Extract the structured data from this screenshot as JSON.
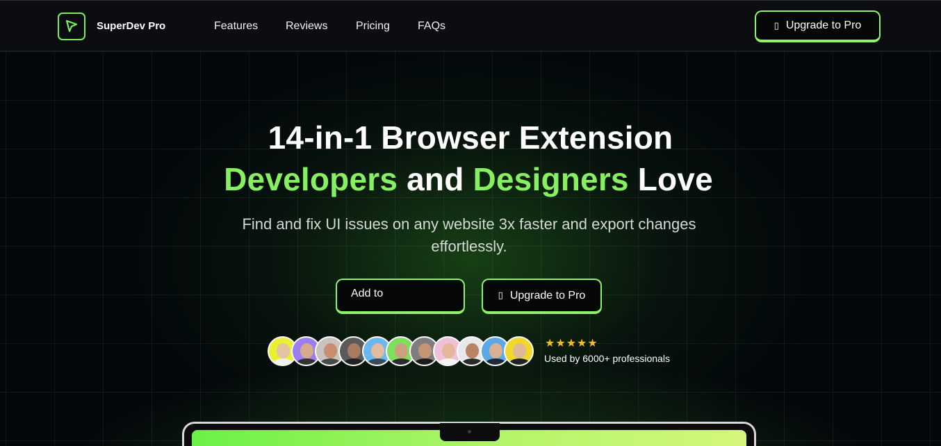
{
  "header": {
    "brand": "SuperDev Pro",
    "nav": [
      "Features",
      "Reviews",
      "Pricing",
      "FAQs"
    ],
    "cta_label": "Upgrade to Pro",
    "cta_icon": "crown-icon"
  },
  "hero": {
    "title_line1": "14-in-1 Browser Extension",
    "title_line2_accent1": "Developers",
    "title_line2_mid": " and ",
    "title_line2_accent2": "Designers",
    "title_line2_end": " Love",
    "subtitle": "Find and fix UI issues on any website 3x faster and export changes effortlessly.",
    "add_button_label": "Add to",
    "upgrade_button_label": "Upgrade to Pro",
    "social_proof": "Used by 6000+ professionals",
    "rating": 4.5,
    "stars": "★★★★★"
  },
  "colors": {
    "accent": "#86f060",
    "background": "#03060a",
    "star": "#f5b82e"
  }
}
